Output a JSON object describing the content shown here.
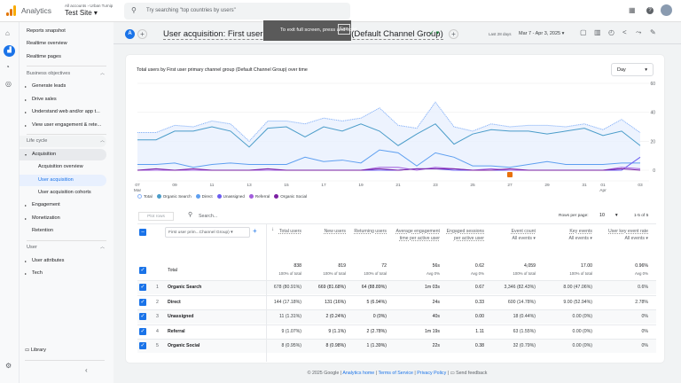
{
  "topbar": {
    "product": "Analytics",
    "breadcrumb": "All accounts › Urban Turnip",
    "property": "Test Site",
    "search_placeholder": "Try searching \"top countries by users\""
  },
  "toast": {
    "text": "To exit full screen, press and hold",
    "key": "Esc"
  },
  "header": {
    "avatar_letter": "A",
    "title": "User acquisition: First user primary channel group (Default Channel Group)",
    "date_label": "Last 28 days",
    "date_range": "Mar 7 - Apr 3, 2025"
  },
  "nav": {
    "top": [
      "Reports snapshot",
      "Realtime overview",
      "Realtime pages"
    ],
    "business_title": "Business objectives",
    "business": [
      "Generate leads",
      "Drive sales",
      "Understand web and/or app t...",
      "View user engagement & rete..."
    ],
    "lifecycle_title": "Life cycle",
    "acquisition": "Acquisition",
    "acq_items": [
      "Acquisition overview",
      "User acquisition",
      "User acquisition cohorts"
    ],
    "lifecycle": [
      "Engagement",
      "Monetization",
      "Retention"
    ],
    "user_title": "User",
    "user": [
      "User attributes",
      "Tech"
    ],
    "library": "Library"
  },
  "chart_data": {
    "type": "line",
    "title": "Total users by First user primary channel group (Default Channel Group) over time",
    "granularity": "Day",
    "ylim": [
      0,
      60
    ],
    "yticks": [
      "60",
      "40",
      "20",
      "0"
    ],
    "x": [
      "07",
      "08",
      "09",
      "10",
      "11",
      "12",
      "13",
      "14",
      "15",
      "16",
      "17",
      "18",
      "19",
      "20",
      "21",
      "22",
      "23",
      "24",
      "25",
      "26",
      "27",
      "28",
      "29",
      "30",
      "31",
      "01",
      "02",
      "03"
    ],
    "xtick_labels": [
      {
        "d": "07",
        "m": "Mar"
      },
      {
        "d": "09"
      },
      {
        "d": "11"
      },
      {
        "d": "13"
      },
      {
        "d": "15"
      },
      {
        "d": "17"
      },
      {
        "d": "19"
      },
      {
        "d": "21"
      },
      {
        "d": "23"
      },
      {
        "d": "25"
      },
      {
        "d": "27"
      },
      {
        "d": "29"
      },
      {
        "d": "31"
      },
      {
        "d": "01",
        "m": "Apr"
      },
      {
        "d": "03"
      }
    ],
    "annotation": {
      "date": "27",
      "color": "#e8710a"
    },
    "series": [
      {
        "name": "Total",
        "color": "#8ab4f8",
        "values": [
          26,
          26,
          31,
          30,
          34,
          32,
          20,
          34,
          34,
          32,
          36,
          34,
          36,
          43,
          31,
          29,
          47,
          30,
          27,
          32,
          30,
          31,
          31,
          30,
          32,
          28,
          35,
          26
        ]
      },
      {
        "name": "Organic Search",
        "color": "#4a9cc9",
        "values": [
          21,
          21,
          27,
          27,
          30,
          27,
          16,
          29,
          30,
          23,
          30,
          27,
          32,
          27,
          17,
          25,
          32,
          18,
          25,
          28,
          27,
          27,
          25,
          27,
          29,
          24,
          27,
          17
        ]
      },
      {
        "name": "Direct",
        "color": "#5e9ff0",
        "values": [
          4,
          4,
          5,
          2,
          4,
          5,
          4,
          4,
          4,
          9,
          6,
          7,
          5,
          14,
          12,
          3,
          12,
          9,
          3,
          3,
          2,
          4,
          6,
          4,
          4,
          4,
          5,
          5
        ]
      },
      {
        "name": "Unassigned",
        "color": "#6b5cf0",
        "values": [
          0,
          0,
          0,
          0,
          0,
          0,
          0,
          0,
          0,
          0,
          0,
          0,
          0,
          0,
          0,
          1,
          1,
          0,
          0,
          0,
          0,
          0,
          0,
          0,
          0,
          0,
          0,
          9
        ]
      },
      {
        "name": "Referral",
        "color": "#a25ddc",
        "values": [
          0,
          0,
          0,
          0,
          0,
          0,
          0,
          0,
          0,
          0,
          0,
          0,
          0,
          2,
          2,
          0,
          2,
          1,
          0,
          1,
          0,
          0,
          0,
          0,
          0,
          0,
          2,
          1
        ]
      },
      {
        "name": "Organic Social",
        "color": "#7b1fa2",
        "values": [
          0,
          1,
          0,
          1,
          0,
          0,
          0,
          1,
          0,
          0,
          0,
          0,
          0,
          1,
          0,
          1,
          1,
          1,
          0,
          0,
          1,
          0,
          0,
          0,
          0,
          0,
          1,
          0
        ]
      }
    ]
  },
  "table": {
    "plot_rows": "Plot rows",
    "search_placeholder": "Search...",
    "rows_per_page_label": "Rows per page:",
    "rows_per_page": "10",
    "pagination": "1-5 of 5",
    "dimension": "First user prim...Channel Group)",
    "columns": [
      {
        "label": "Total users"
      },
      {
        "label": "New users"
      },
      {
        "label": "Returning users"
      },
      {
        "label": "Average engagement time per active user"
      },
      {
        "label": "Engaged sessions per active user"
      },
      {
        "label": "Event count",
        "filter": "All events"
      },
      {
        "label": "Key events",
        "filter": "All events"
      },
      {
        "label": "User key event rate",
        "filter": "All events"
      }
    ],
    "total": {
      "label": "Total",
      "values": [
        "838",
        "819",
        "72",
        "56s",
        "0.62",
        "4,059",
        "17.00",
        "0.96%"
      ],
      "subs": [
        "100% of total",
        "100% of total",
        "100% of total",
        "Avg 0%",
        "Avg 0%",
        "100% of total",
        "100% of total",
        "Avg 0%"
      ]
    },
    "rows": [
      {
        "n": "1",
        "name": "Organic Search",
        "values": [
          "678 (80.91%)",
          "669 (81.68%)",
          "64 (88.89%)",
          "1m 03s",
          "0.67",
          "3,346 (82.43%)",
          "8.00 (47.06%)",
          "0.6%"
        ]
      },
      {
        "n": "2",
        "name": "Direct",
        "values": [
          "144 (17.18%)",
          "131 (16%)",
          "5 (6.94%)",
          "24s",
          "0.33",
          "600 (14.78%)",
          "9.00 (52.94%)",
          "2.78%"
        ]
      },
      {
        "n": "3",
        "name": "Unassigned",
        "values": [
          "11 (1.31%)",
          "2 (0.24%)",
          "0 (0%)",
          "40s",
          "0.00",
          "18 (0.44%)",
          "0.00 (0%)",
          "0%"
        ]
      },
      {
        "n": "4",
        "name": "Referral",
        "values": [
          "9 (1.07%)",
          "9 (1.1%)",
          "2 (2.78%)",
          "1m 19s",
          "1.11",
          "63 (1.55%)",
          "0.00 (0%)",
          "0%"
        ]
      },
      {
        "n": "5",
        "name": "Organic Social",
        "values": [
          "8 (0.95%)",
          "8 (0.98%)",
          "1 (1.39%)",
          "22s",
          "0.38",
          "32 (0.79%)",
          "0.00 (0%)",
          "0%"
        ]
      }
    ]
  },
  "footer": {
    "copyright": "© 2025 Google",
    "links": [
      "Analytics home",
      "Terms of Service",
      "Privacy Policy"
    ],
    "feedback": "Send feedback"
  }
}
